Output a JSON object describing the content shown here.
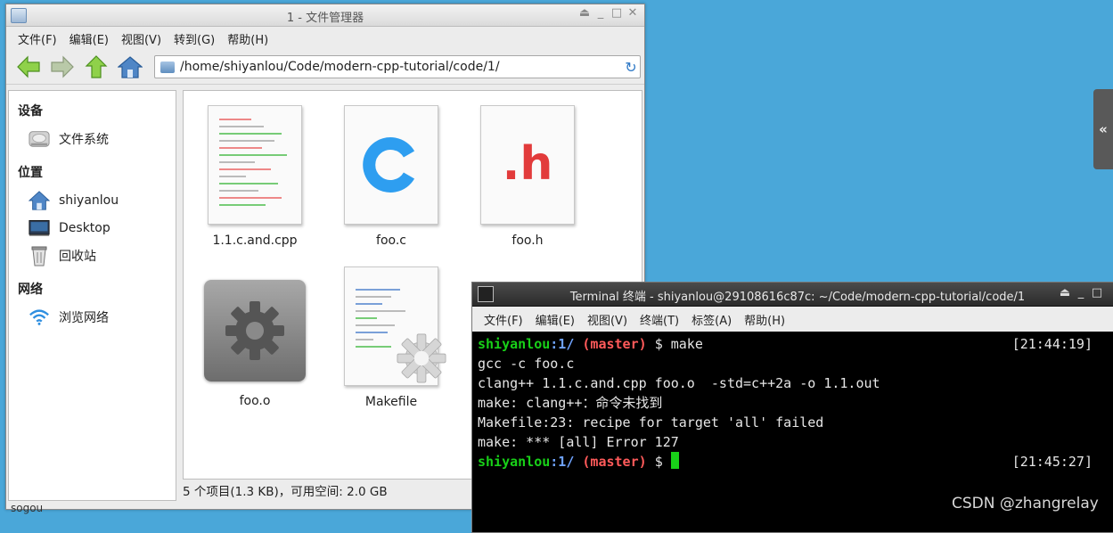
{
  "file_manager": {
    "title": "1 - 文件管理器",
    "menu": [
      "文件(F)",
      "编辑(E)",
      "视图(V)",
      "转到(G)",
      "帮助(H)"
    ],
    "path": "/home/shiyanlou/Code/modern-cpp-tutorial/code/1/",
    "sidebar": {
      "devices_header": "设备",
      "devices": [
        {
          "label": "文件系统",
          "icon": "harddisk-icon"
        }
      ],
      "places_header": "位置",
      "places": [
        {
          "label": "shiyanlou",
          "icon": "home-icon"
        },
        {
          "label": "Desktop",
          "icon": "desktop-icon"
        },
        {
          "label": "回收站",
          "icon": "trash-icon"
        }
      ],
      "network_header": "网络",
      "network": [
        {
          "label": "浏览网络",
          "icon": "wifi-icon"
        }
      ]
    },
    "files": [
      {
        "name": "1.1.c.and.cpp",
        "icon": "text-file-icon"
      },
      {
        "name": "foo.c",
        "icon": "c-source-icon"
      },
      {
        "name": "foo.h",
        "icon": "c-header-icon"
      },
      {
        "name": "foo.o",
        "icon": "object-file-icon"
      },
      {
        "name": "Makefile",
        "icon": "makefile-icon"
      }
    ],
    "status": "5 个项目(1.3 KB)，可用空间: 2.0 GB",
    "colors": {
      "header_c": "#2e9ef0",
      "header_h": "#e23b3b"
    }
  },
  "terminal": {
    "title": "Terminal 终端 - shiyanlou@29108616c87c: ~/Code/modern-cpp-tutorial/code/1",
    "menu": [
      "文件(F)",
      "编辑(E)",
      "视图(V)",
      "终端(T)",
      "标签(A)",
      "帮助(H)"
    ],
    "prompt_user": "shiyanlou",
    "prompt_dir": ":1/",
    "prompt_branch": "(master)",
    "prompt_symbol": "$",
    "command": "make",
    "time1": "[21:44:19]",
    "time2": "[21:45:27]",
    "output": [
      "gcc -c foo.c",
      "clang++ 1.1.c.and.cpp foo.o  -std=c++2a -o 1.1.out",
      "make: clang++：命令未找到",
      "Makefile:23: recipe for target 'all' failed",
      "make: *** [all] Error 127"
    ]
  },
  "side_panel": {
    "label": "«"
  },
  "watermark": "CSDN @zhangrelay",
  "taskbar_text": "sogou"
}
